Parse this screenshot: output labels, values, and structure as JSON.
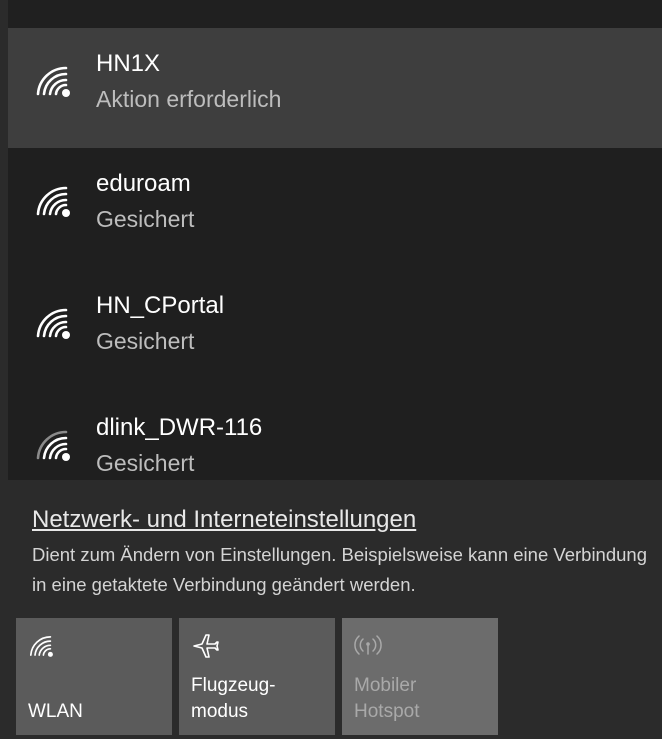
{
  "networks": [
    {
      "name": "HN1X",
      "status": "Aktion erforderlich",
      "selected": true
    },
    {
      "name": "eduroam",
      "status": "Gesichert",
      "selected": false
    },
    {
      "name": "HN_CPortal",
      "status": "Gesichert",
      "selected": false
    },
    {
      "name": "dlink_DWR-116",
      "status": "Gesichert",
      "selected": false
    }
  ],
  "settings": {
    "link_label": "Netzwerk- und Interneteinstellungen",
    "description": "Dient zum Ändern von Einstellungen. Beispielsweise kann eine Verbindung in eine getaktete Verbindung geändert werden."
  },
  "quick_actions": [
    {
      "label": "WLAN",
      "icon": "wifi-icon",
      "enabled": true
    },
    {
      "label": "Flugzeug-\nmodus",
      "icon": "airplane-icon",
      "enabled": true
    },
    {
      "label": "Mobiler\nHotspot",
      "icon": "hotspot-icon",
      "enabled": false
    }
  ],
  "colors": {
    "panel_bg": "#1f1f1f",
    "selected_bg": "#3e3e3e",
    "tile_bg": "#5b5b5b",
    "tile_disabled_bg": "#6c6c6c"
  }
}
